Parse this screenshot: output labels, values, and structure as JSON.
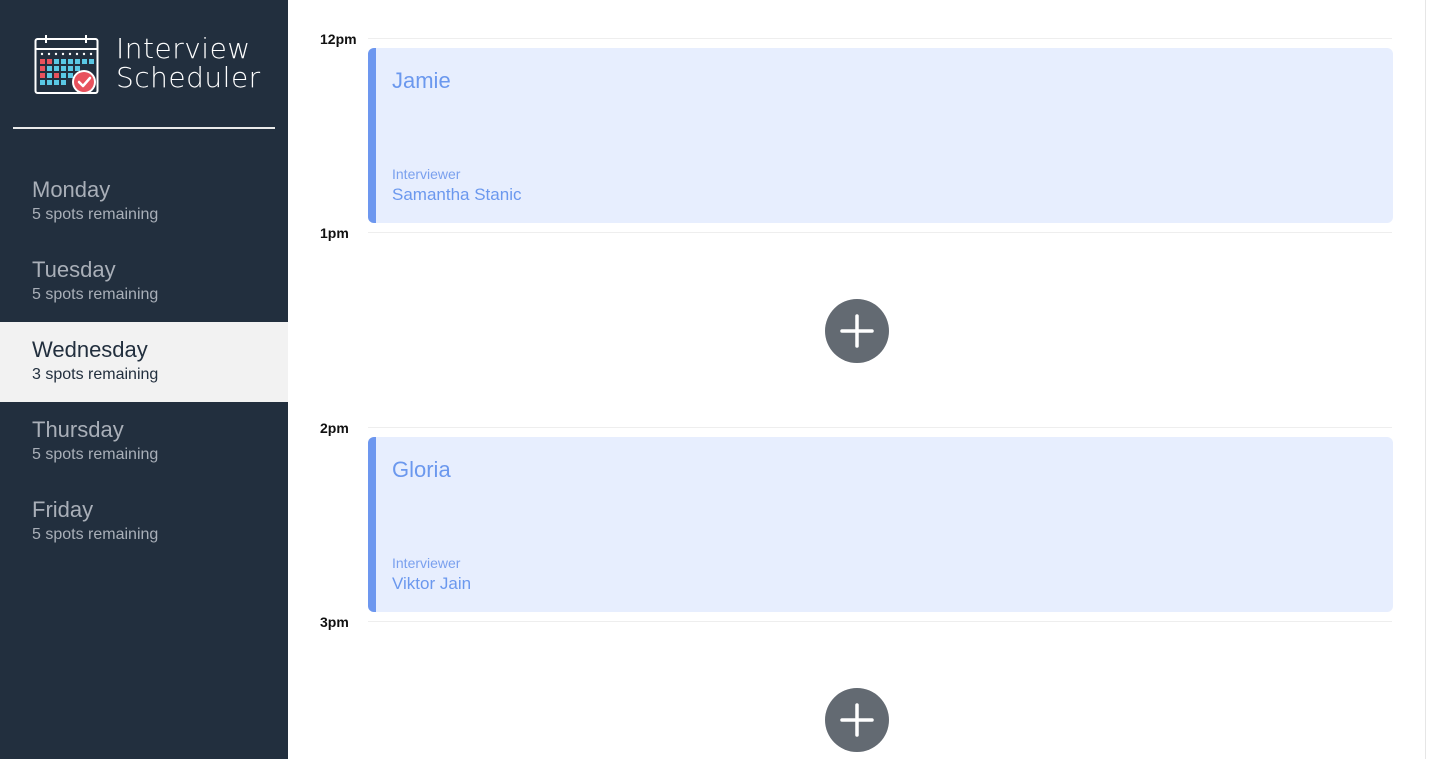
{
  "app": {
    "title_line1": "Interview",
    "title_line2": "Scheduler"
  },
  "sidebar": {
    "days": [
      {
        "name": "Monday",
        "spots": "5 spots remaining",
        "selected": false
      },
      {
        "name": "Tuesday",
        "spots": "5 spots remaining",
        "selected": false
      },
      {
        "name": "Wednesday",
        "spots": "3 spots remaining",
        "selected": true
      },
      {
        "name": "Thursday",
        "spots": "5 spots remaining",
        "selected": false
      },
      {
        "name": "Friday",
        "spots": "5 spots remaining",
        "selected": false
      }
    ]
  },
  "schedule": {
    "times": [
      "12pm",
      "1pm",
      "2pm",
      "3pm"
    ],
    "appointments": [
      {
        "student": "Jamie",
        "interviewer_label": "Interviewer",
        "interviewer": "Samantha Stanic"
      },
      {
        "student": "Gloria",
        "interviewer_label": "Interviewer",
        "interviewer": "Viktor Jain"
      }
    ]
  },
  "icons": {
    "logo": "calendar-check-icon",
    "add": "plus-icon"
  },
  "colors": {
    "sidebar_bg": "#222f3e",
    "selected_bg": "#f2f2f2",
    "card_bg": "#e7eefe",
    "accent": "#6d97ef",
    "add_button": "#636a72"
  }
}
